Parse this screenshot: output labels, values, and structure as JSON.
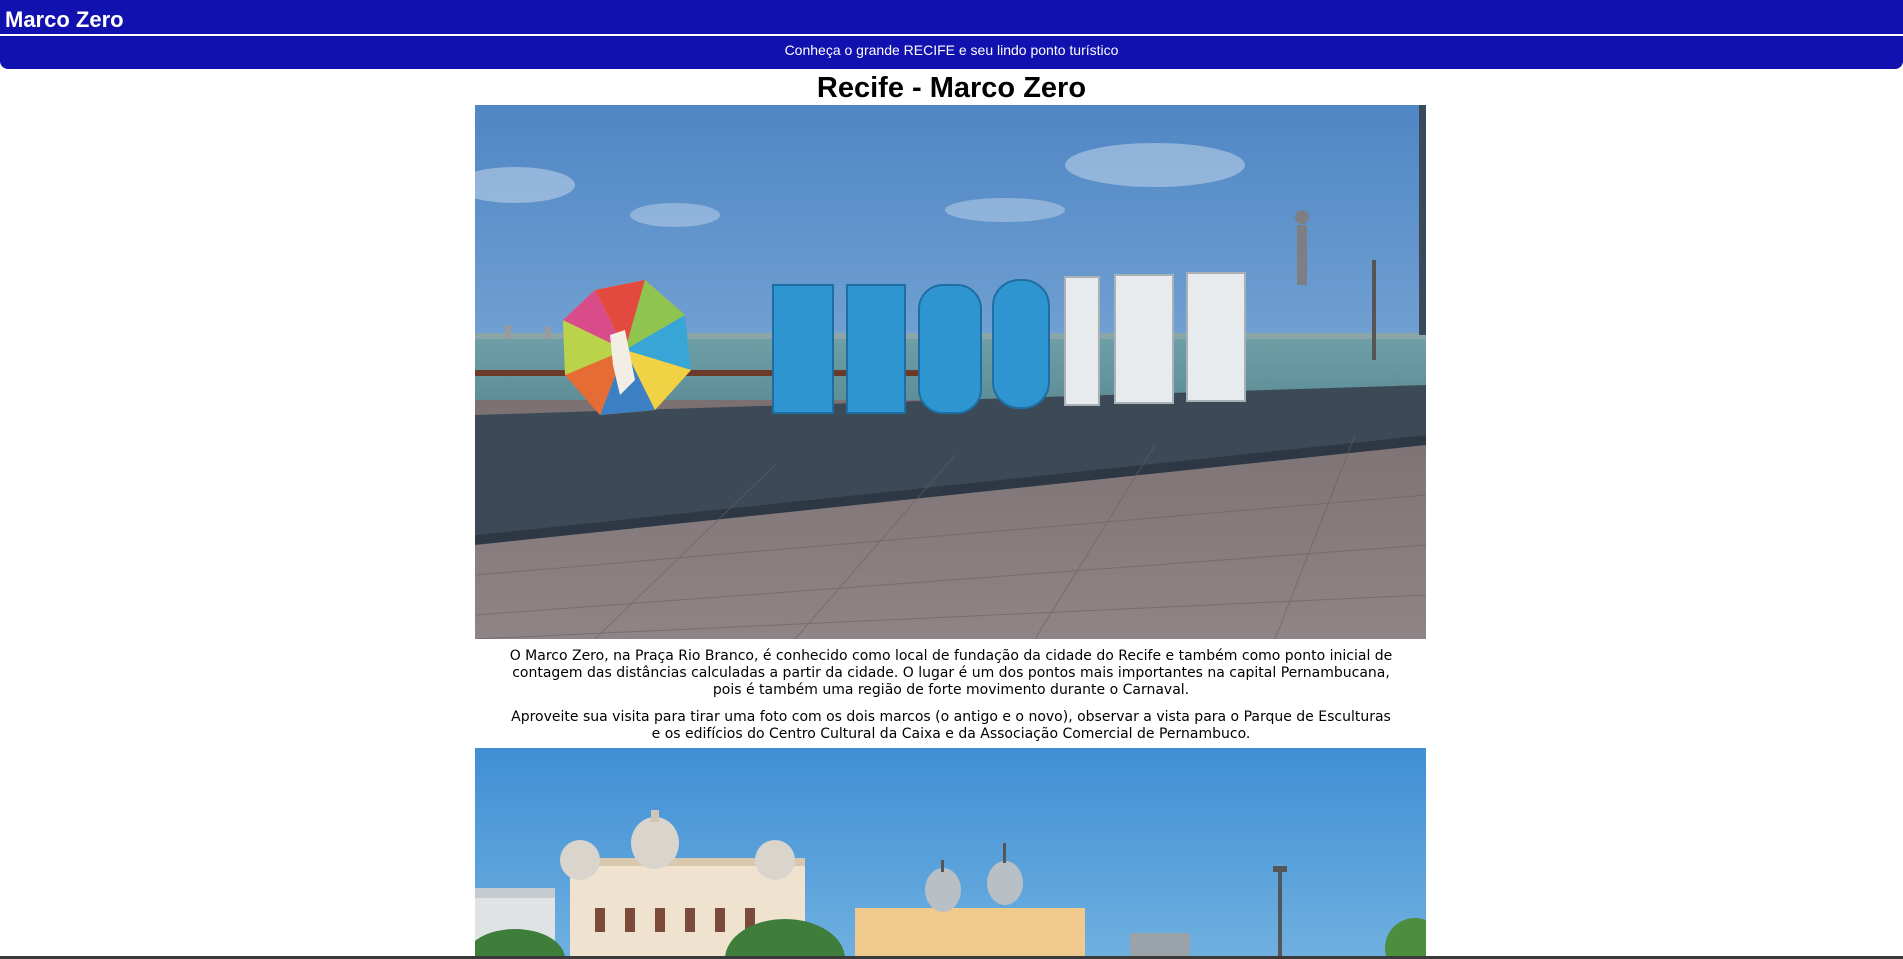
{
  "header": {
    "site_title": "Marco Zero",
    "tagline": "Conheça o grande RECIFE e seu lindo ponto turístico",
    "background_color": "#1111b0"
  },
  "main": {
    "heading": "Recife - Marco Zero",
    "paragraphs": [
      "O Marco Zero, na Praça Rio Branco, é conhecido como local de fundação da cidade do Recife e também como ponto inicial de contagem das distâncias calculadas a partir da cidade. O lugar é um dos pontos mais importantes na capital Pernambucana, pois é também uma região de forte movimento durante o Carnaval.",
      "Aproveite sua visita para tirar uma foto com os dois marcos (o antigo e o novo), observar a vista para o Parque de Esculturas e os edifícios do Centro Cultural da Caixa e da Associação Comercial de Pernambuco."
    ],
    "photos": [
      {
        "sign_text": "RECIFE"
      },
      {
        "subject": "historic-buildings"
      }
    ]
  }
}
